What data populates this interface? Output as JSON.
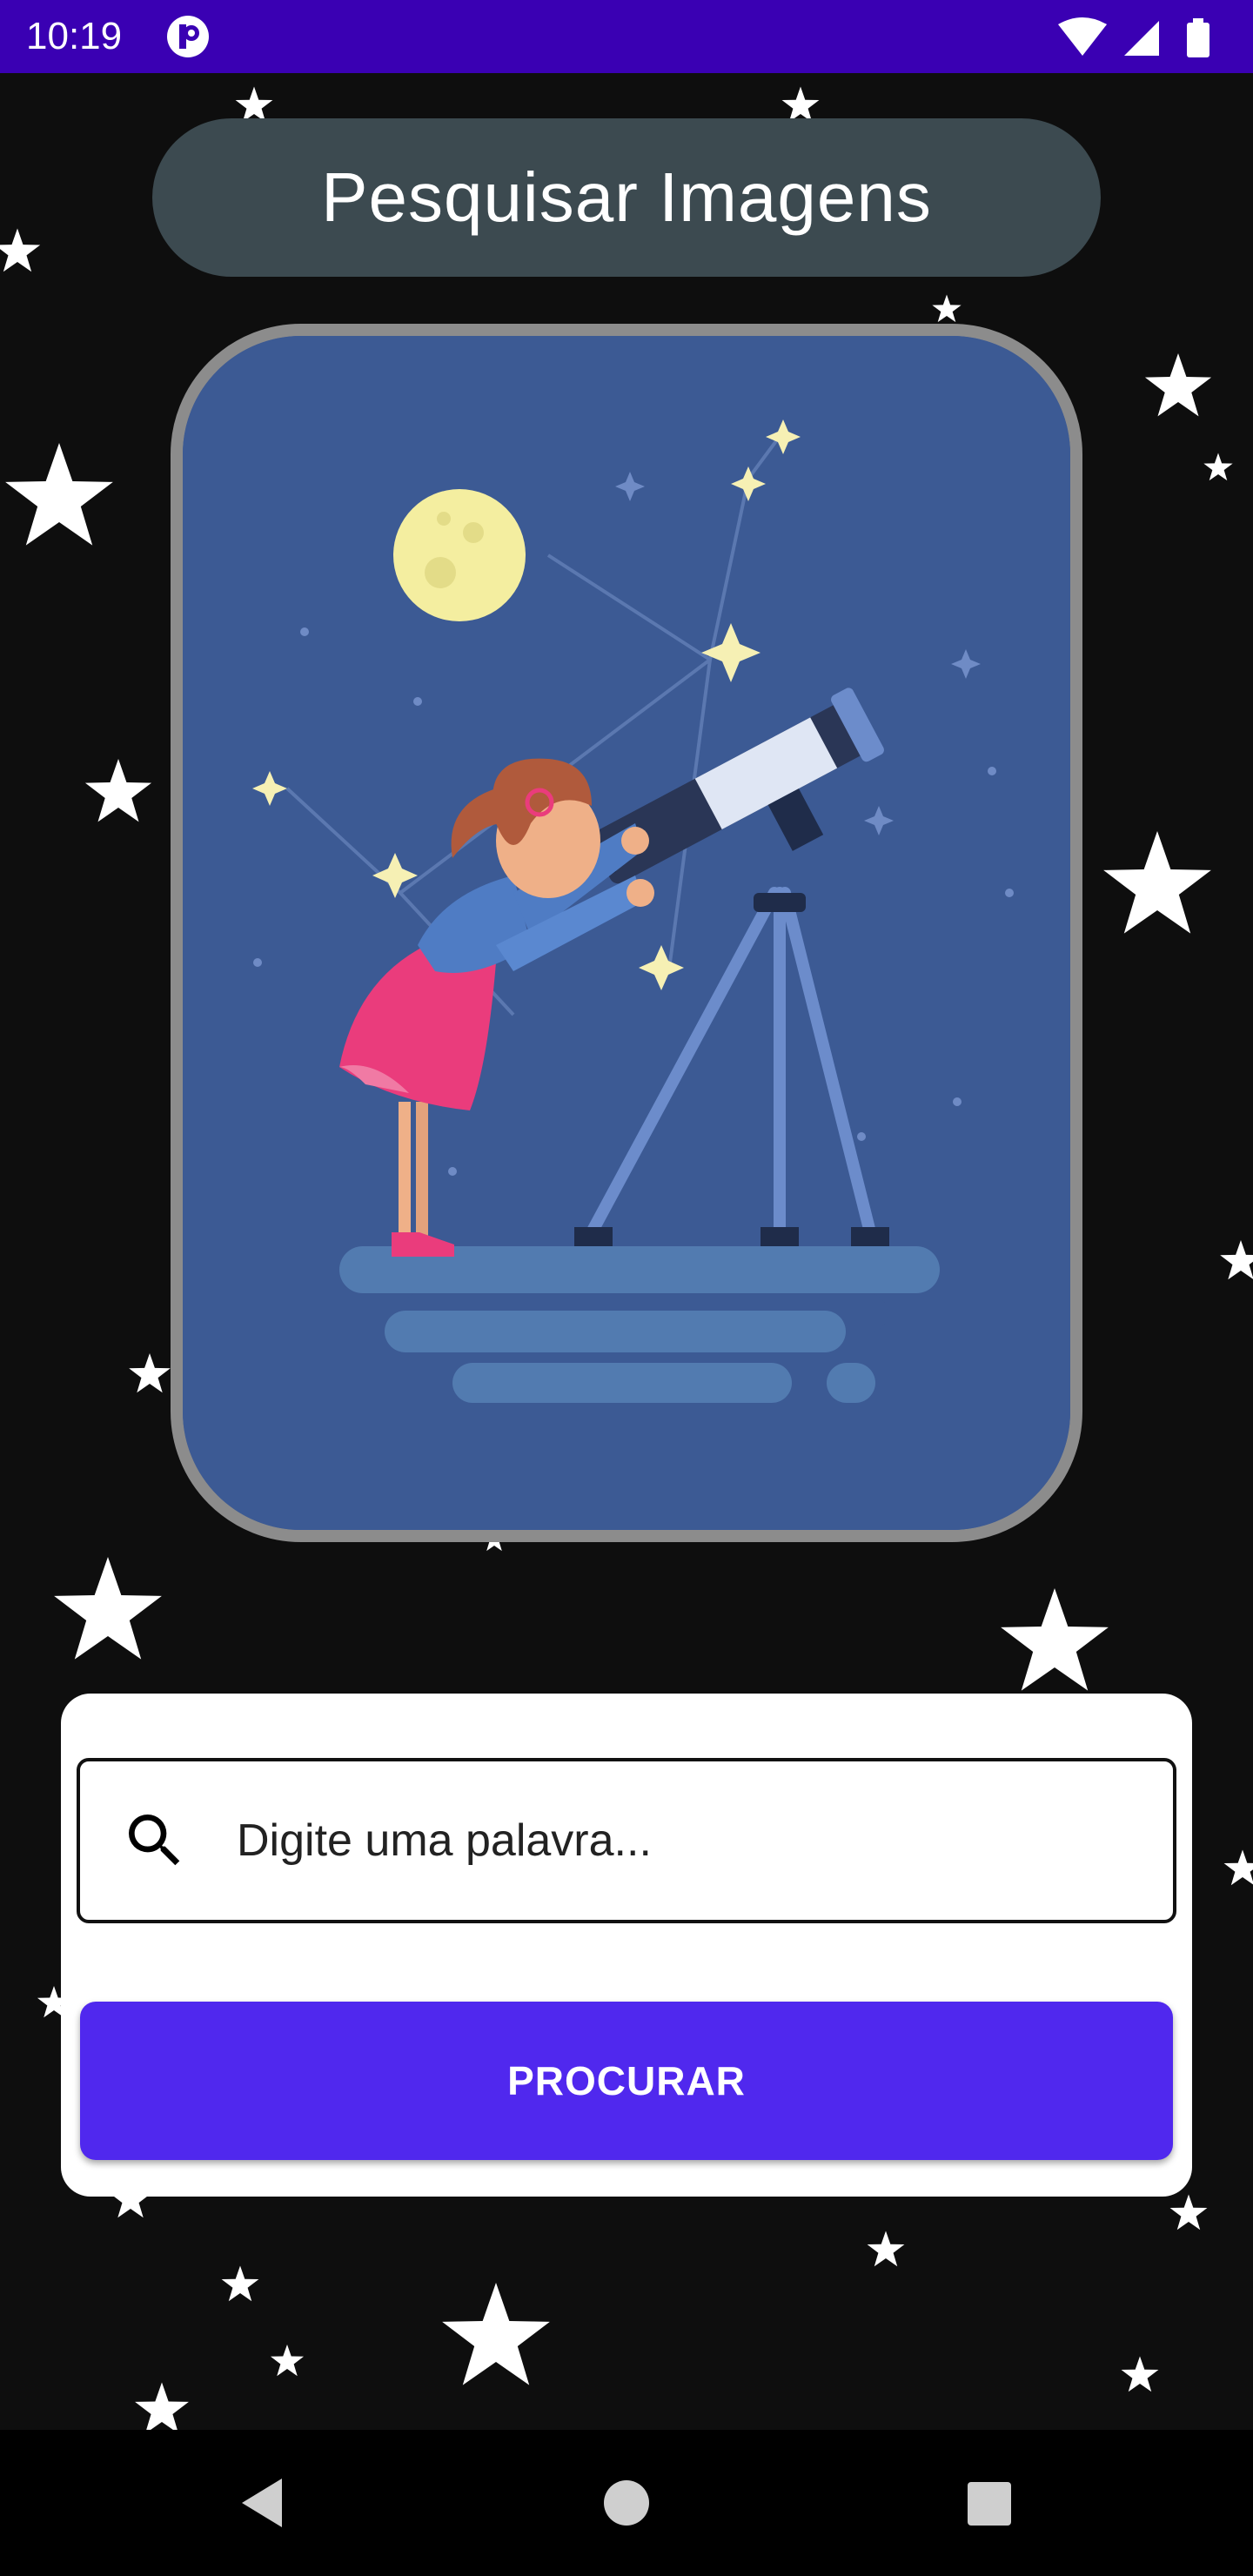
{
  "status_bar": {
    "time": "10:19",
    "icons": [
      "app-notification-icon",
      "wifi-icon",
      "signal-icon",
      "battery-icon"
    ]
  },
  "header": {
    "title": "Pesquisar Imagens"
  },
  "illustration": {
    "subject": "girl-with-telescope-under-night-sky",
    "colors": {
      "sky": "#3c5a94",
      "frame": "#8c8c8c",
      "moon": "#f4eea0"
    }
  },
  "search": {
    "icon": "search-icon",
    "placeholder": "Digite uma palavra...",
    "value": "",
    "button_label": "PROCURAR"
  },
  "nav_bar": {
    "buttons": [
      "back-icon",
      "home-icon",
      "recents-icon"
    ]
  },
  "colors": {
    "status_bar": "#3a00b3",
    "background": "#0e0e0e",
    "title_pill": "#3c4a50",
    "accent": "#5028ee"
  }
}
